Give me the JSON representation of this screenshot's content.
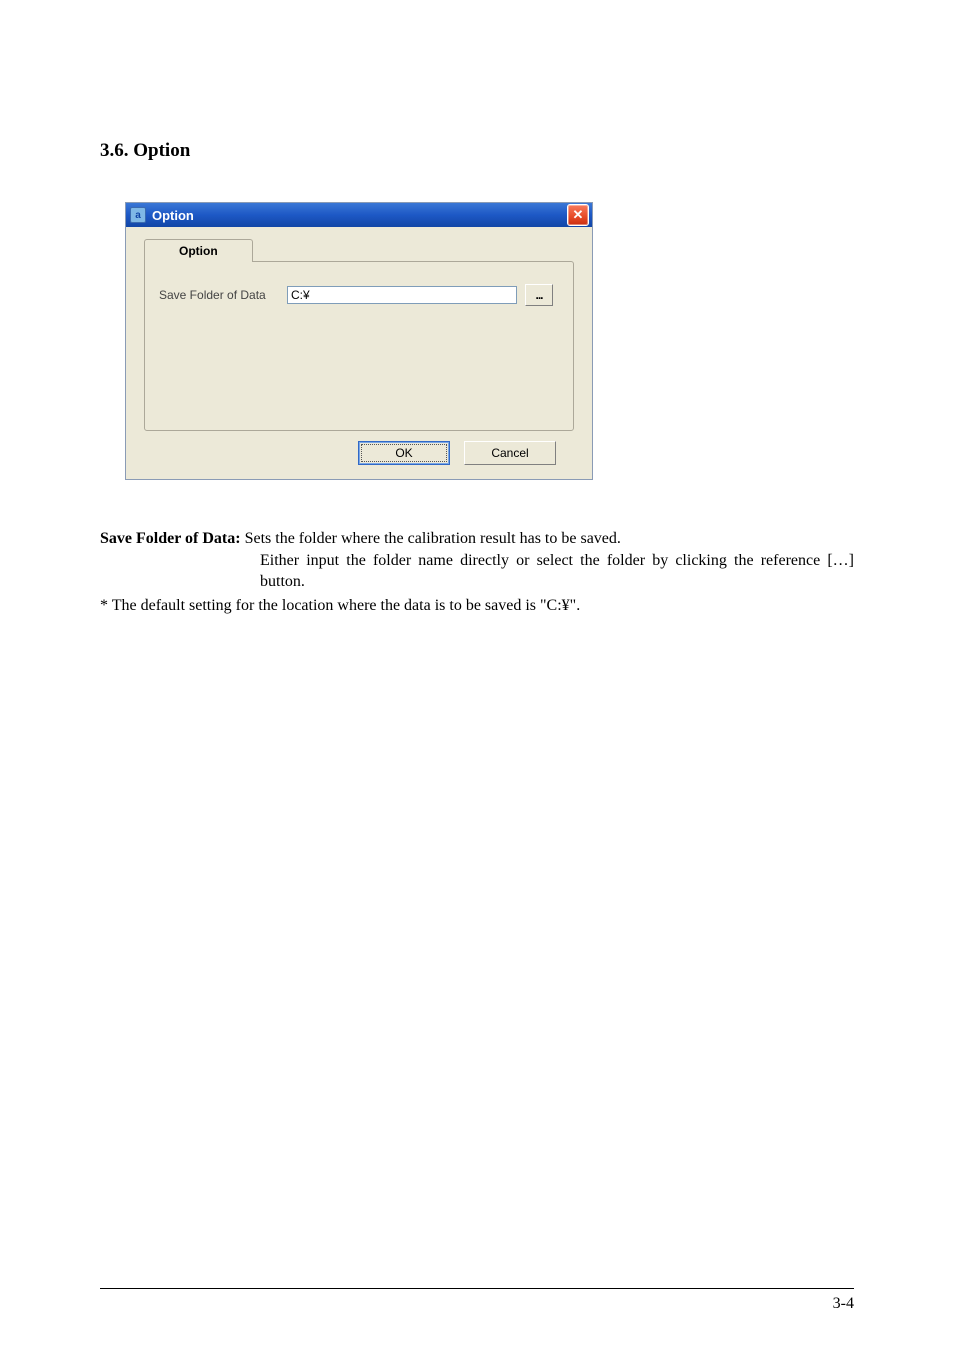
{
  "section": {
    "heading": "3.6.  Option"
  },
  "dialog": {
    "title": "Option",
    "tab_label": "Option",
    "field_label": "Save Folder of Data",
    "field_value": "C:¥",
    "browse_label": "...",
    "ok_label": "OK",
    "cancel_label": "Cancel",
    "close_glyph": "✕",
    "app_icon_glyph": "a"
  },
  "description": {
    "label": "Save Folder of Data:",
    "line1": " Sets the folder where the calibration result has to be saved.",
    "line2": "Either input the folder name directly or select the folder by clicking the reference […] button.",
    "note": "* The default setting for the location where the data is to be saved is \"C:¥\"."
  },
  "footer": {
    "page_number": "3-4"
  }
}
